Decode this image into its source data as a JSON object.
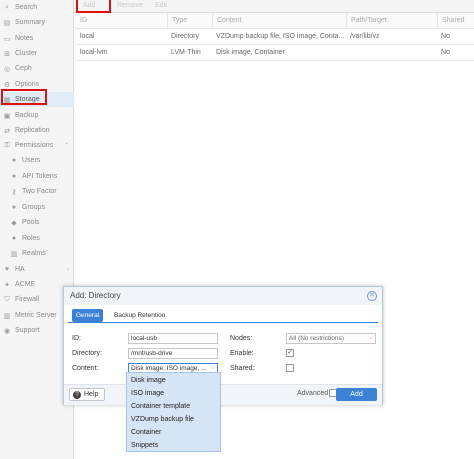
{
  "sidebar": {
    "items": [
      {
        "label": "Search",
        "icon": "search-icon",
        "glyph": "⌕"
      },
      {
        "label": "Summary",
        "icon": "summary-icon",
        "glyph": "▤"
      },
      {
        "label": "Notes",
        "icon": "notes-icon",
        "glyph": "▭"
      },
      {
        "label": "Cluster",
        "icon": "cluster-icon",
        "glyph": "⊞"
      },
      {
        "label": "Ceph",
        "icon": "ceph-icon",
        "glyph": "◎"
      },
      {
        "label": "Options",
        "icon": "gear-icon",
        "glyph": "⚙"
      },
      {
        "label": "Storage",
        "icon": "database-icon",
        "glyph": "▦"
      },
      {
        "label": "Backup",
        "icon": "floppy-icon",
        "glyph": "▣"
      },
      {
        "label": "Replication",
        "icon": "replication-icon",
        "glyph": "⇄"
      },
      {
        "label": "Permissions",
        "icon": "unlock-icon",
        "glyph": "⚿"
      },
      {
        "label": "Users",
        "icon": "user-icon",
        "glyph": "●"
      },
      {
        "label": "API Tokens",
        "icon": "user-tag-icon",
        "glyph": "●"
      },
      {
        "label": "Two Factor",
        "icon": "key-icon",
        "glyph": "⚷"
      },
      {
        "label": "Groups",
        "icon": "users-icon",
        "glyph": "●"
      },
      {
        "label": "Pools",
        "icon": "tags-icon",
        "glyph": "◆"
      },
      {
        "label": "Roles",
        "icon": "male-icon",
        "glyph": "●"
      },
      {
        "label": "Realms",
        "icon": "building-icon",
        "glyph": "▥"
      },
      {
        "label": "HA",
        "icon": "heartbeat-icon",
        "glyph": "♥"
      },
      {
        "label": "ACME",
        "icon": "certificate-icon",
        "glyph": "✦"
      },
      {
        "label": "Firewall",
        "icon": "shield-icon",
        "glyph": "⛉"
      },
      {
        "label": "Metric Server",
        "icon": "chart-icon",
        "glyph": "▥"
      },
      {
        "label": "Support",
        "icon": "support-icon",
        "glyph": "◉"
      }
    ]
  },
  "toolbar": {
    "add_label": "Add",
    "remove_label": "Remove",
    "edit_label": "Edit"
  },
  "grid": {
    "columns": [
      "ID",
      "Type",
      "Content",
      "Path/Target",
      "Shared"
    ],
    "rows": [
      [
        "local",
        "Directory",
        "VZDump backup file, ISO image, Conta...",
        "/var/lib/vz",
        "No"
      ],
      [
        "local-lvm",
        "LVM-Thin",
        "Disk image, Container",
        "",
        "No"
      ]
    ]
  },
  "dialog": {
    "title": "Add: Directory",
    "tabs": [
      "General",
      "Backup Retention"
    ],
    "fields": {
      "id_label": "ID:",
      "id_value": "local-usb",
      "directory_label": "Directory:",
      "directory_value": "/mnt/usb-drive",
      "content_label": "Content:",
      "content_value": "Disk image, ISO image, ...",
      "nodes_label": "Nodes:",
      "nodes_value": "All (No restrictions)",
      "enable_label": "Enable:",
      "shared_label": "Shared:"
    },
    "enable_checked": true,
    "shared_checked": false,
    "help_label": "Help",
    "advanced_label": "Advanced",
    "advanced_checked": false,
    "add_label": "Add"
  },
  "content_dropdown": {
    "options": [
      "Disk image",
      "ISO image",
      "Container template",
      "VZDump backup file",
      "Container",
      "Snippets"
    ]
  },
  "colors": {
    "accent": "#3b82d6",
    "highlight_red": "#dd1111",
    "dropdown_bg": "#d6e5f5"
  }
}
